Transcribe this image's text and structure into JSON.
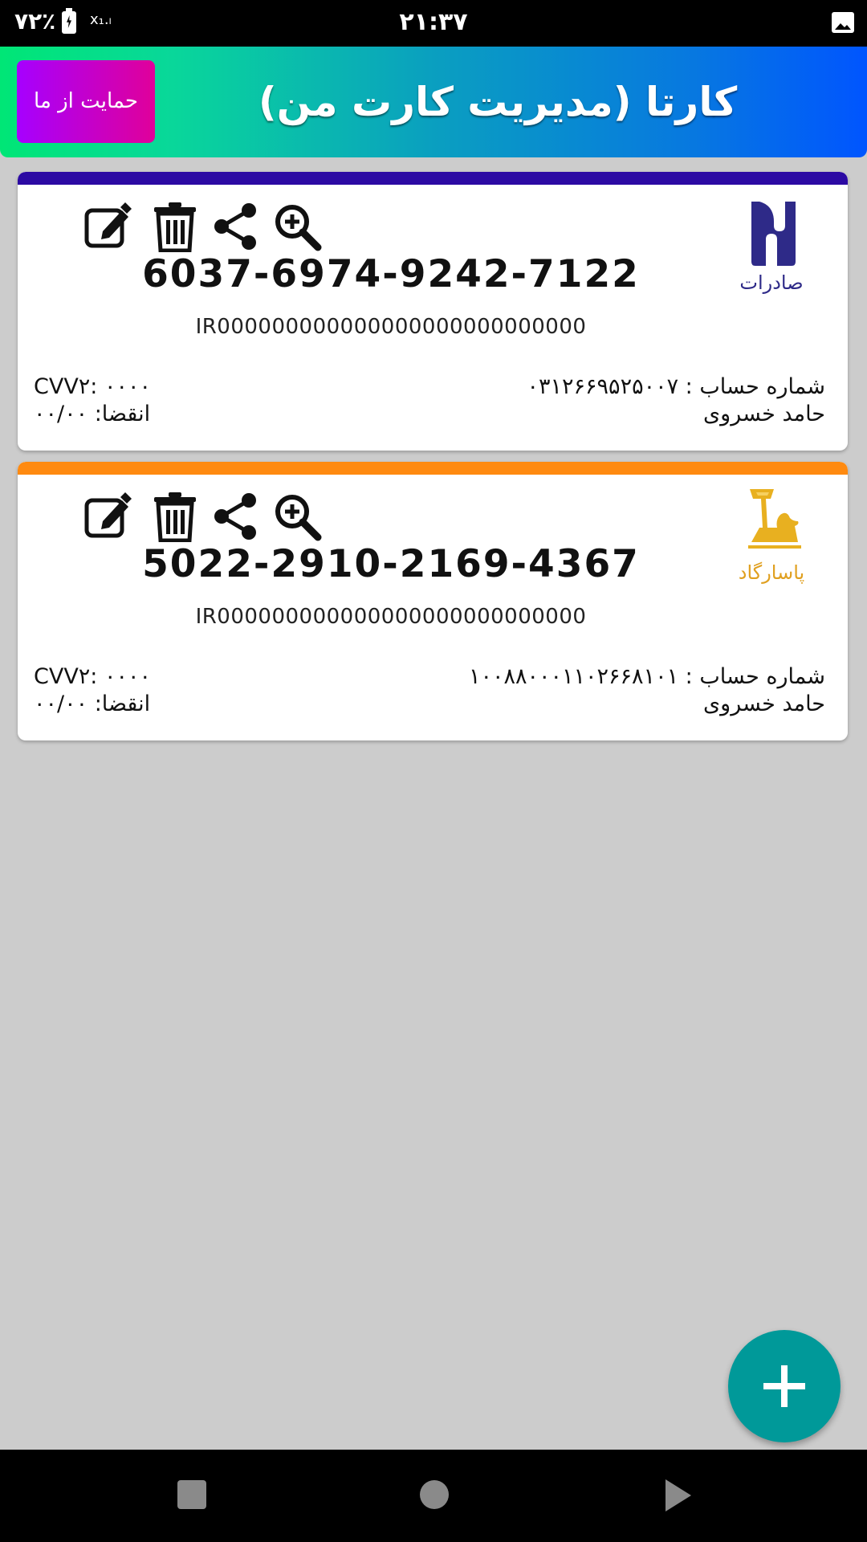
{
  "status_bar": {
    "battery_percent": "۷۲٪",
    "signal": "x₁.ₗ",
    "time": "۲۱:۳۷",
    "icons": [
      "battery-charging-icon",
      "signal-icon",
      "gallery-icon"
    ]
  },
  "header": {
    "title": "کارتا (مدیریت کارت من)",
    "support_label": "حمایت از ما"
  },
  "cards": [
    {
      "bank_name": "صادرات",
      "bank_color": "#2e2a88",
      "strip_color": "#2c0aa3",
      "card_number": "6037-6974-9242-7122",
      "iban": "IR000000000000000000000000000",
      "account_label": "شماره حساب :",
      "account_number": "۰۳۱۲۶۶۹۵۲۵۰۰۷",
      "owner": "حامد خسروی",
      "cvv": "CVV۲: ۰۰۰۰",
      "expiry": "انقضا: ۰۰/۰۰"
    },
    {
      "bank_name": "پاسارگاد",
      "bank_color": "#e0a020",
      "strip_color": "#ff8a10",
      "card_number": "5022-2910-2169-4367",
      "iban": "IR000000000000000000000000000",
      "account_label": "شماره حساب :",
      "account_number": "۱۰۰۸۸۰۰۰۱۱۰۲۶۶۸۱۰۱",
      "owner": "حامد خسروی",
      "cvv": "CVV۲: ۰۰۰۰",
      "expiry": "انقضا: ۰۰/۰۰"
    }
  ],
  "card_action_icons": [
    "edit-icon",
    "delete-icon",
    "share-icon",
    "zoom-icon"
  ],
  "fab_icon": "plus-icon",
  "nav_icons": [
    "recents-icon",
    "home-icon",
    "back-icon"
  ],
  "accent_color": "#009999"
}
